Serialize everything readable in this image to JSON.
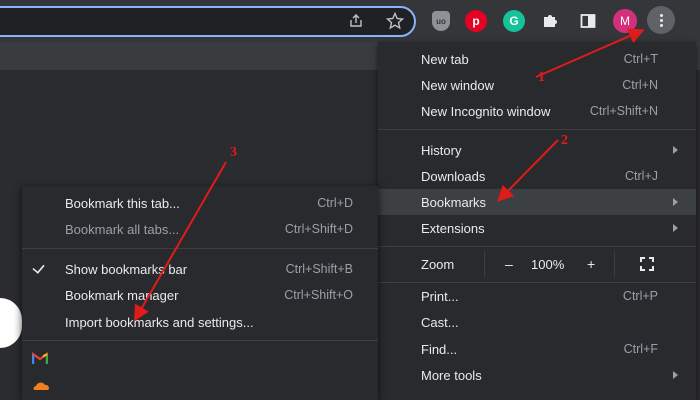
{
  "toolbar": {
    "extensions": [
      {
        "name": "ublock-origin",
        "text": "uo"
      },
      {
        "name": "pinterest",
        "text": "p"
      },
      {
        "name": "grammarly",
        "text": "G"
      }
    ],
    "avatar_letter": "M"
  },
  "main_menu": {
    "items": [
      {
        "label": "New tab",
        "shortcut": "Ctrl+T"
      },
      {
        "label": "New window",
        "shortcut": "Ctrl+N"
      },
      {
        "label": "New Incognito window",
        "shortcut": "Ctrl+Shift+N"
      },
      {
        "label": "History",
        "shortcut": ""
      },
      {
        "label": "Downloads",
        "shortcut": "Ctrl+J"
      },
      {
        "label": "Bookmarks",
        "shortcut": ""
      },
      {
        "label": "Extensions",
        "shortcut": ""
      },
      {
        "label": "Print...",
        "shortcut": "Ctrl+P"
      },
      {
        "label": "Cast...",
        "shortcut": ""
      },
      {
        "label": "Find...",
        "shortcut": "Ctrl+F"
      },
      {
        "label": "More tools",
        "shortcut": ""
      }
    ],
    "zoom": {
      "label": "Zoom",
      "minus": "–",
      "value": "100%",
      "plus": "+"
    }
  },
  "bookmarks_submenu": {
    "items": [
      {
        "label": "Bookmark this tab...",
        "shortcut": "Ctrl+D"
      },
      {
        "label": "Bookmark all tabs...",
        "shortcut": "Ctrl+Shift+D"
      },
      {
        "label": "Show bookmarks bar",
        "shortcut": "Ctrl+Shift+B"
      },
      {
        "label": "Bookmark manager",
        "shortcut": "Ctrl+Shift+O"
      },
      {
        "label": "Import bookmarks and settings...",
        "shortcut": ""
      }
    ]
  },
  "annotations": {
    "step1": "1",
    "step2": "2",
    "step3": "3",
    "color": "#e11a1a"
  },
  "colors": {
    "menu_bg": "#292a2d",
    "highlight": "#3c4043",
    "focus_ring": "#8ab4f8"
  }
}
